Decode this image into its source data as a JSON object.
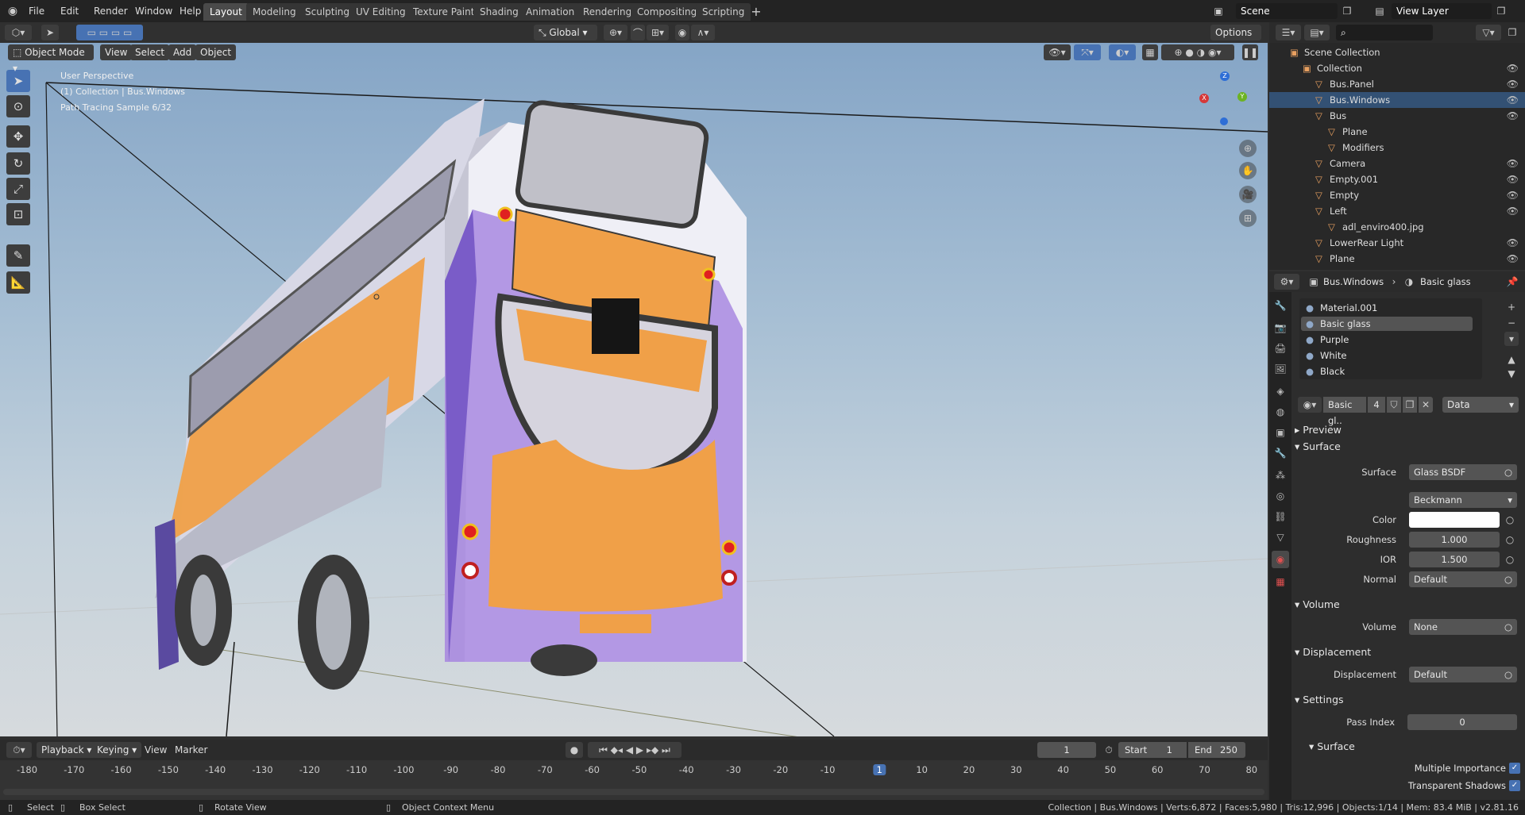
{
  "menu": [
    "File",
    "Edit",
    "Render",
    "Window",
    "Help"
  ],
  "workspaces": [
    "Layout",
    "Modeling",
    "Sculpting",
    "UV Editing",
    "Texture Paint",
    "Shading",
    "Animation",
    "Rendering",
    "Compositing",
    "Scripting"
  ],
  "active_workspace": "Layout",
  "scene": "Scene",
  "view_layer": "View Layer",
  "transform_orientation": "Global",
  "options_label": "Options",
  "mode": "Object Mode",
  "viewport_menu": [
    "View",
    "Select",
    "Add",
    "Object"
  ],
  "viewport_info": {
    "perspective": "User Perspective",
    "collection": "(1) Collection | Bus.Windows",
    "sampling": "Path Tracing Sample 6/32"
  },
  "outliner": {
    "rows": [
      {
        "label": "Scene Collection",
        "indent": 0,
        "sel": false,
        "eye": false
      },
      {
        "label": "Collection",
        "indent": 1,
        "sel": false,
        "eye": true
      },
      {
        "label": "Bus.Panel",
        "indent": 2,
        "sel": false,
        "eye": true
      },
      {
        "label": "Bus.Windows",
        "indent": 2,
        "sel": true,
        "eye": true
      },
      {
        "label": "Bus",
        "indent": 2,
        "sel": false,
        "eye": true
      },
      {
        "label": "Plane",
        "indent": 3,
        "sel": false,
        "eye": false
      },
      {
        "label": "Modifiers",
        "indent": 3,
        "sel": false,
        "eye": false
      },
      {
        "label": "Camera",
        "indent": 2,
        "sel": false,
        "eye": true
      },
      {
        "label": "Empty.001",
        "indent": 2,
        "sel": false,
        "eye": true
      },
      {
        "label": "Empty",
        "indent": 2,
        "sel": false,
        "eye": true
      },
      {
        "label": "Left",
        "indent": 2,
        "sel": false,
        "eye": true
      },
      {
        "label": "adl_enviro400.jpg",
        "indent": 3,
        "sel": false,
        "eye": false
      },
      {
        "label": "LowerRear Light",
        "indent": 2,
        "sel": false,
        "eye": true
      },
      {
        "label": "Plane",
        "indent": 2,
        "sel": false,
        "eye": true
      }
    ]
  },
  "properties": {
    "breadcrumb_object": "Bus.Windows",
    "breadcrumb_material": "Basic glass",
    "material_slots": [
      "Material.001",
      "Basic glass",
      "Purple",
      "White",
      "Black"
    ],
    "selected_slot": "Basic glass",
    "material_name": "Basic gl..",
    "user_count": "4",
    "link": "Data",
    "sections": {
      "preview": "Preview",
      "surface": "Surface",
      "volume": "Volume",
      "displacement": "Displacement",
      "settings": "Settings",
      "settings_surface": "Surface"
    },
    "surface": {
      "surface_label": "Surface",
      "surface_value": "Glass BSDF",
      "distribution": "Beckmann",
      "color_label": "Color",
      "roughness_label": "Roughness",
      "roughness": "1.000",
      "ior_label": "IOR",
      "ior": "1.500",
      "normal_label": "Normal",
      "normal": "Default"
    },
    "volume": {
      "label": "Volume",
      "value": "None"
    },
    "displacement": {
      "label": "Displacement",
      "value": "Default"
    },
    "settings": {
      "pass_index_label": "Pass Index",
      "pass_index": "0",
      "multiple_importance": "Multiple Importance",
      "transparent_shadows": "Transparent Shadows"
    }
  },
  "timeline": {
    "menus": [
      "Playback",
      "Keying",
      "View",
      "Marker"
    ],
    "current_frame": "1",
    "start_label": "Start",
    "start": "1",
    "end_label": "End",
    "end": "250",
    "ticks": [
      "-180",
      "-170",
      "-160",
      "-150",
      "-140",
      "-130",
      "-120",
      "-110",
      "-100",
      "-90",
      "-80",
      "-70",
      "-60",
      "-50",
      "-40",
      "-30",
      "-20",
      "-10",
      "1",
      "10",
      "20",
      "30",
      "40",
      "50",
      "60",
      "70",
      "80"
    ]
  },
  "statusbar": {
    "select": "Select",
    "box_select": "Box Select",
    "rotate_view": "Rotate View",
    "context_menu": "Object Context Menu",
    "stats": "Collection | Bus.Windows | Verts:6,872 | Faces:5,980 | Tris:12,996 | Objects:1/14 | Mem: 83.4 MiB | v2.81.16"
  },
  "colors": {
    "accent": "#4772b3",
    "selection": "#335174",
    "orange": "#f0a048",
    "purple": "#8a5fd0"
  }
}
